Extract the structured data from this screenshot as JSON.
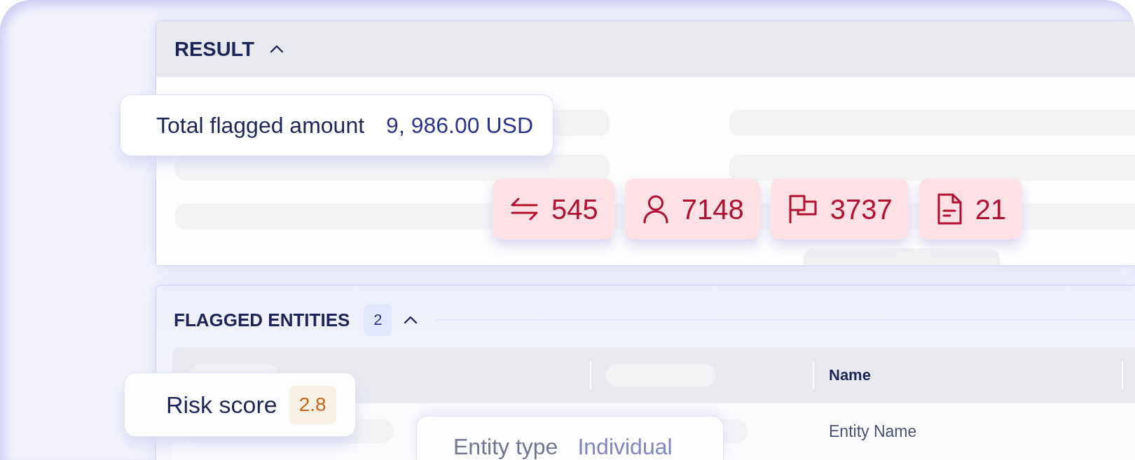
{
  "result_panel": {
    "title": "RESULT",
    "expanded": true
  },
  "total_card": {
    "label": "Total flagged amount",
    "value": "9, 986.00 USD"
  },
  "stats": [
    {
      "kind": "transfers",
      "value": "545"
    },
    {
      "kind": "person",
      "value": "7148"
    },
    {
      "kind": "flag",
      "value": "3737"
    },
    {
      "kind": "document",
      "value": "21"
    }
  ],
  "flagged_panel": {
    "title": "FLAGGED ENTITIES",
    "count": "2",
    "expanded": true
  },
  "table": {
    "name_header": "Name",
    "rows": [
      {
        "name": "Entity Name"
      }
    ]
  },
  "risk_card": {
    "label": "Risk score",
    "value": "2.8"
  },
  "entity_card": {
    "label": "Entity type",
    "value": "Individual"
  }
}
